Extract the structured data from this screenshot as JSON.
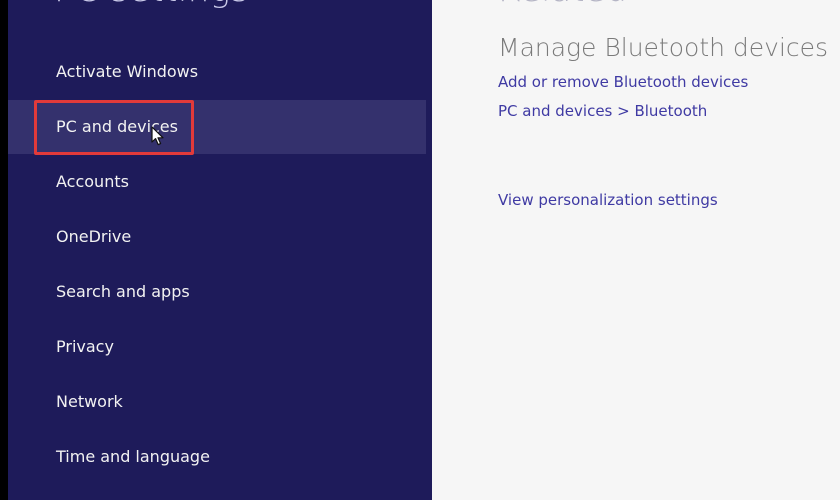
{
  "sidebar": {
    "title": "PC settings",
    "items": [
      {
        "label": "Activate Windows",
        "selected": false
      },
      {
        "label": "PC and devices",
        "selected": true
      },
      {
        "label": "Accounts",
        "selected": false
      },
      {
        "label": "OneDrive",
        "selected": false
      },
      {
        "label": "Search and apps",
        "selected": false
      },
      {
        "label": "Privacy",
        "selected": false
      },
      {
        "label": "Network",
        "selected": false
      },
      {
        "label": "Time and language",
        "selected": false
      }
    ]
  },
  "content": {
    "title": "Related",
    "section_heading": "Manage Bluetooth devices",
    "links": {
      "add_remove_bluetooth": "Add or remove Bluetooth devices",
      "pc_devices_bluetooth": "PC and devices > Bluetooth",
      "view_personalization": "View personalization settings"
    }
  },
  "colors": {
    "sidebar_bg": "#1e1b5a",
    "selected_bg": "#34316d",
    "content_bg": "#f6f6f6",
    "link": "#3f3aa3",
    "annotation": "#e23a3a"
  },
  "icons": {
    "cursor": "arrow-cursor-icon"
  }
}
